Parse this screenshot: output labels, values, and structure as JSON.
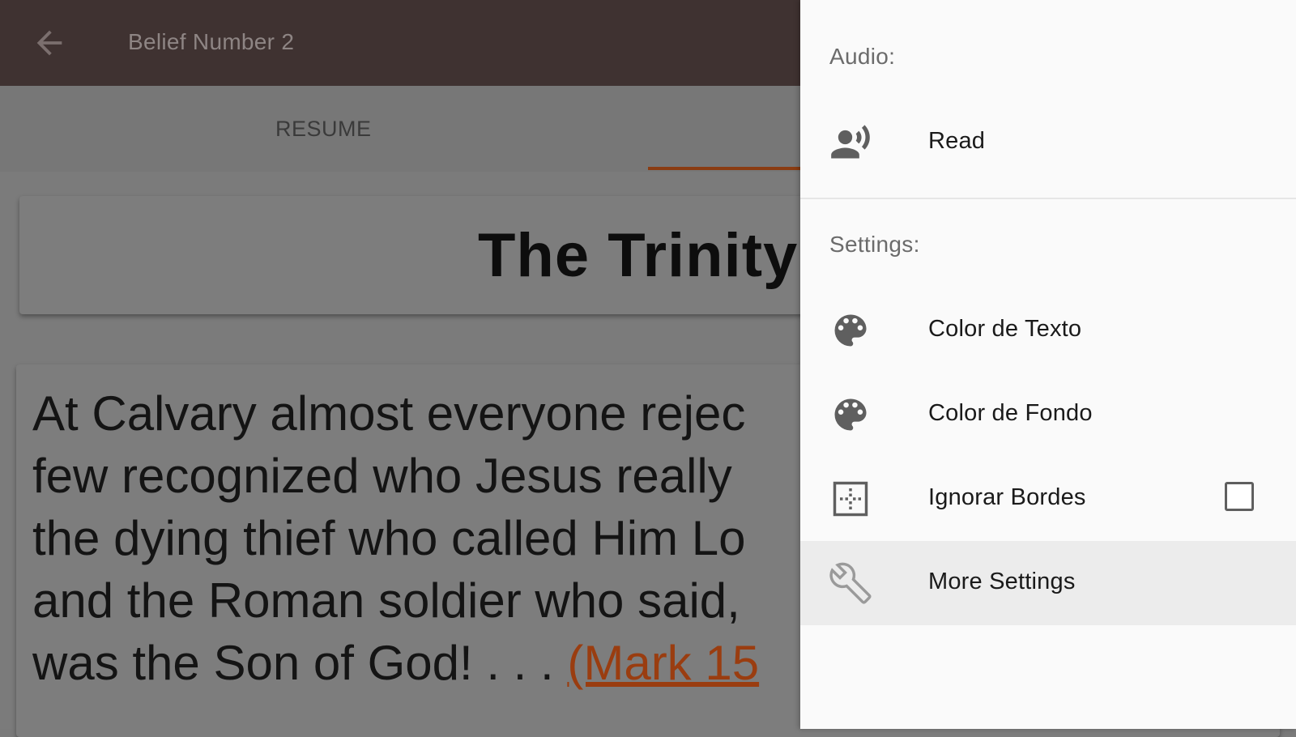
{
  "toolbar": {
    "title": "Belief Number 2",
    "back_icon": "arrow-left-icon"
  },
  "tabs": [
    {
      "label": "RESUME",
      "selected": false
    },
    {
      "label": "",
      "selected": true
    }
  ],
  "content": {
    "card_title": "The Trinity",
    "body_lines": [
      "At Calvary almost everyone rejec",
      "few recognized who Jesus really",
      "the dying thief who called Him Lo",
      "and the Roman soldier who said,",
      "was the Son of God! . . . "
    ],
    "scripture_link": "(Mark 15"
  },
  "drawer": {
    "audio_label": "Audio:",
    "settings_label": "Settings:",
    "items": [
      {
        "label": "Read",
        "icon": "record-voice-icon"
      },
      {
        "label": "Color de Texto",
        "icon": "palette-icon"
      },
      {
        "label": "Color de Fondo",
        "icon": "palette-icon"
      },
      {
        "label": "Ignorar Bordes",
        "icon": "border-clear-icon",
        "checked": false
      },
      {
        "label": "More Settings",
        "icon": "wrench-icon"
      }
    ]
  },
  "colors": {
    "toolbar": "#3f3231",
    "accent": "#8a3c12",
    "drawer_bg": "#fafafa",
    "scrim": "#7b7b7b"
  }
}
